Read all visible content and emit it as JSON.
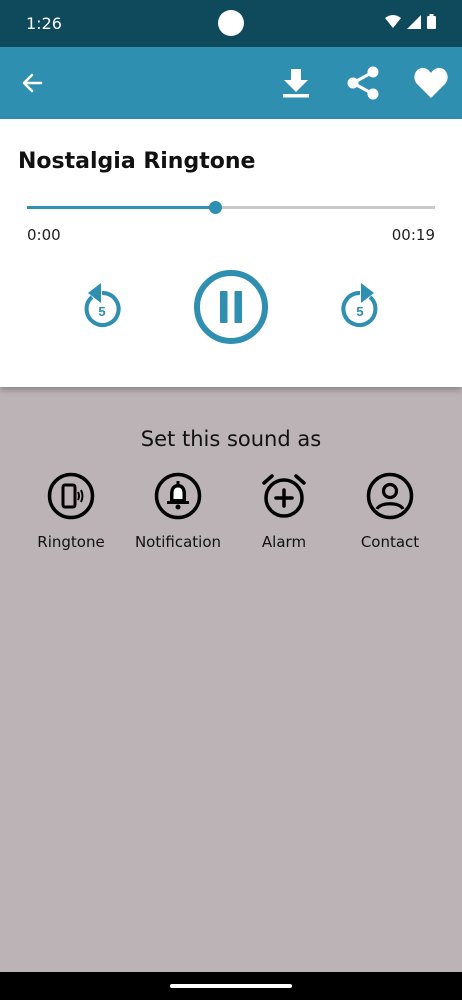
{
  "status_bar": {
    "time": "1:26"
  },
  "app_bar": {
    "back_icon": "back-arrow-icon",
    "actions": [
      "download-icon",
      "share-icon",
      "heart-icon"
    ]
  },
  "player": {
    "title": "Nostalgia Ringtone",
    "progress": 0.46,
    "elapsed": "0:00",
    "duration": "00:19",
    "rewind_seconds": "5",
    "forward_seconds": "5",
    "accent_color": "#2e8fb0"
  },
  "set_as": {
    "title": "Set this sound as",
    "options": [
      {
        "label": "Ringtone",
        "icon": "phone-ringtone-icon"
      },
      {
        "label": "Notification",
        "icon": "bell-icon"
      },
      {
        "label": "Alarm",
        "icon": "alarm-clock-icon"
      },
      {
        "label": "Contact",
        "icon": "contact-icon"
      }
    ]
  }
}
